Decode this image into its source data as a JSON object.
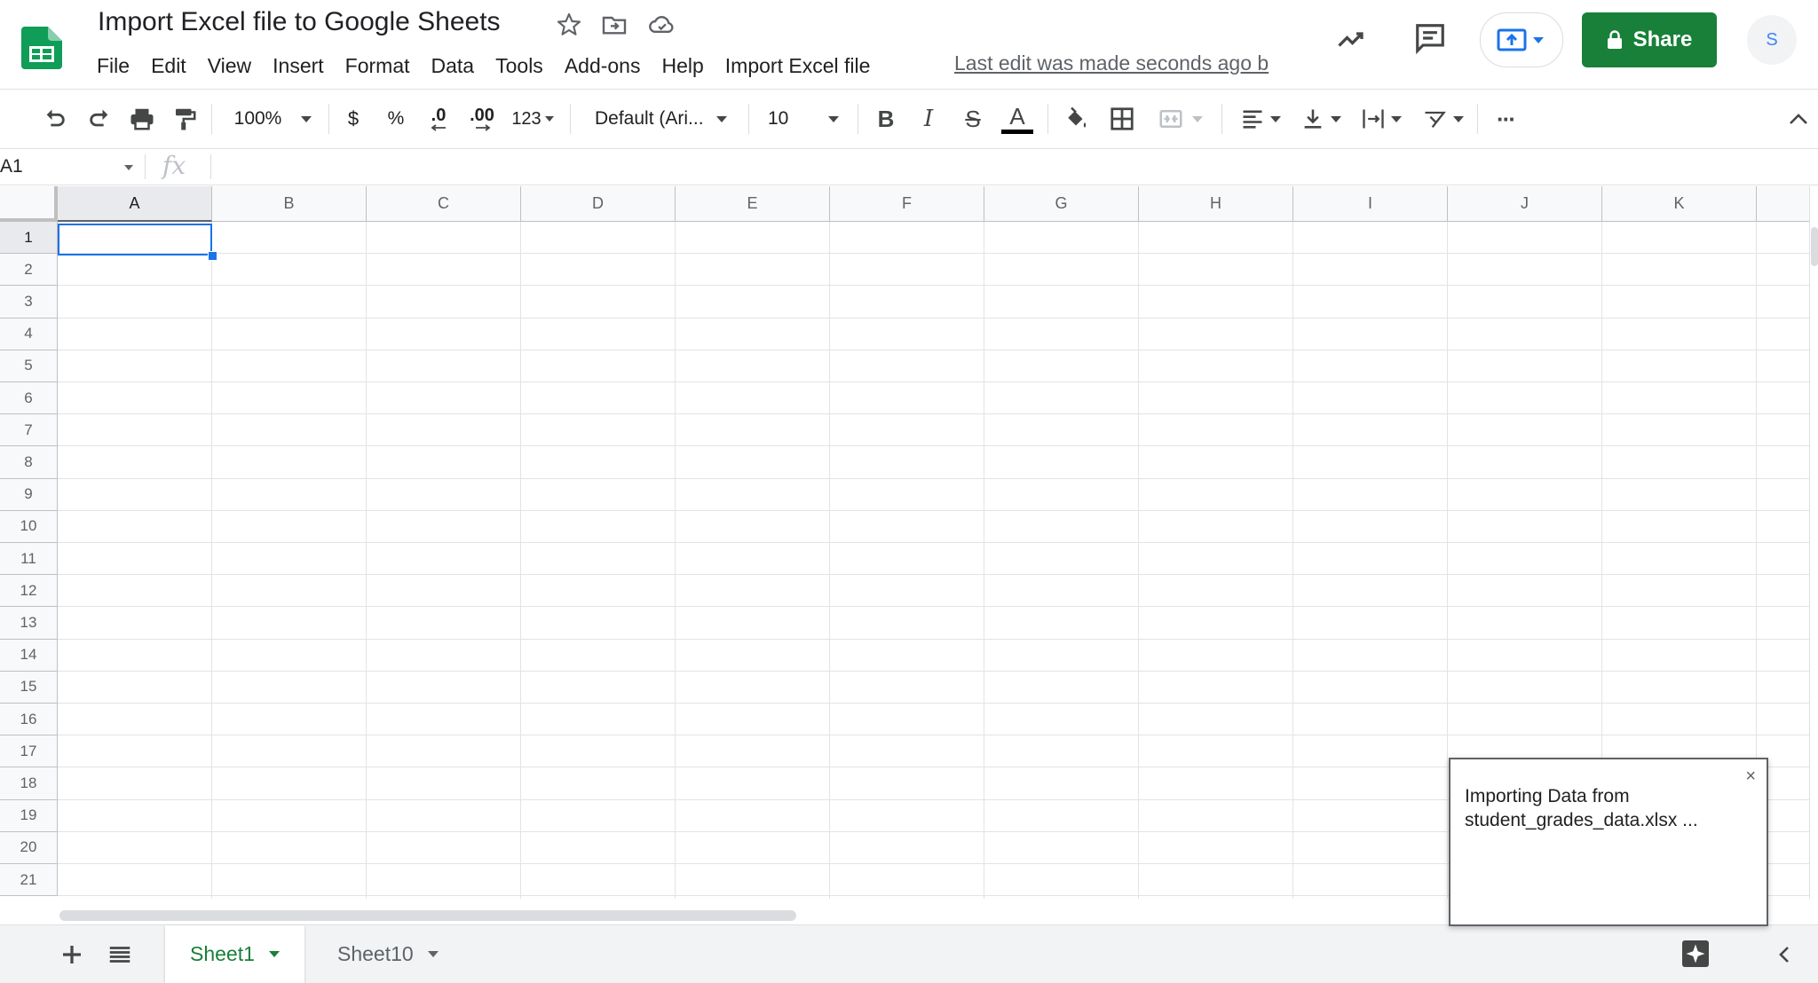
{
  "app": {
    "doc_title": "Import Excel file to Google Sheets",
    "menu": [
      "File",
      "Edit",
      "View",
      "Insert",
      "Format",
      "Data",
      "Tools",
      "Add-ons",
      "Help",
      "Import Excel file"
    ],
    "last_edit": "Last edit was made seconds ago b",
    "share_label": "Share",
    "avatar_initial": "S",
    "colors": {
      "brand_green": "#188038",
      "selection_blue": "#1a73e8",
      "sheets_logo": "#0f9d58"
    }
  },
  "toolbar": {
    "zoom": "100%",
    "currency": "$",
    "percent": "%",
    "dec_decrease": ".0",
    "dec_increase": ".00",
    "more_formats": "123",
    "font_family": "Default (Ari...",
    "font_size": "10",
    "bold": "B",
    "italic": "I",
    "strike": "S",
    "text_color": "A",
    "more": "···"
  },
  "formula_bar": {
    "name_box": "A1",
    "fx": "fx",
    "formula": ""
  },
  "grid": {
    "columns": [
      "A",
      "B",
      "C",
      "D",
      "E",
      "F",
      "G",
      "H",
      "I",
      "J",
      "K"
    ],
    "rows": [
      "1",
      "2",
      "3",
      "4",
      "5",
      "6",
      "7",
      "8",
      "9",
      "10",
      "11",
      "12",
      "13",
      "14",
      "15",
      "16",
      "17",
      "18",
      "19",
      "20",
      "21"
    ],
    "selected_cell": "A1"
  },
  "sheets": {
    "tabs": [
      {
        "label": "Sheet1",
        "active": true
      },
      {
        "label": "Sheet10",
        "active": false
      }
    ]
  },
  "toast": {
    "message": "Importing Data from student_grades_data.xlsx ...",
    "close": "×"
  }
}
